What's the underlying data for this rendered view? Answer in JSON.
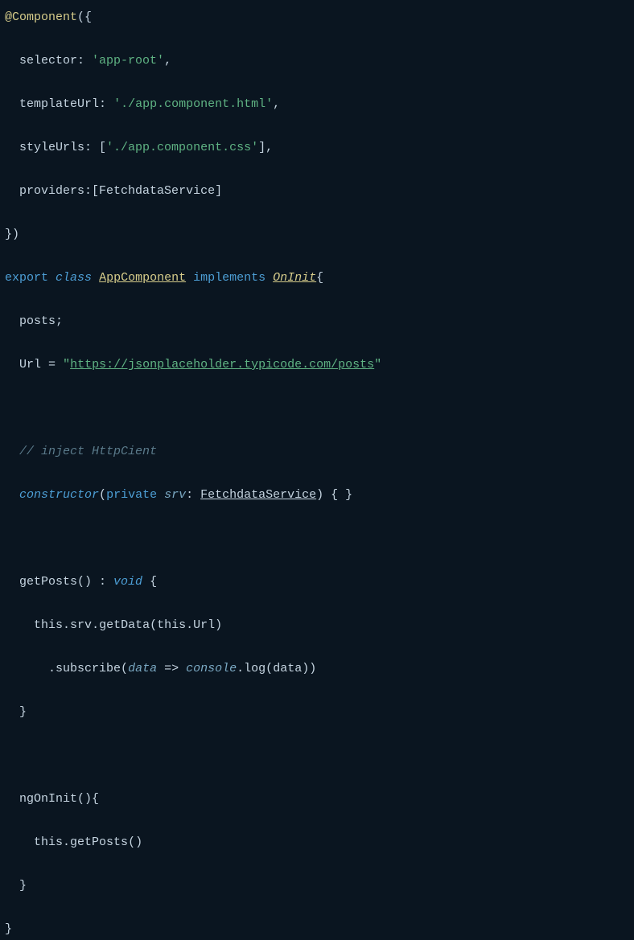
{
  "code": {
    "decorator": "@Component",
    "selectorKey": "selector",
    "selectorVal": "'app-root'",
    "templateUrlKey": "templateUrl",
    "templateUrlVal": "'./app.component.html'",
    "styleUrlsKey": "styleUrls",
    "styleUrlsVal": "'./app.component.css'",
    "providersKey": "providers",
    "providersVal": "FetchdataService",
    "exportKw": "export",
    "classKw": "class",
    "className": "AppComponent",
    "implementsKw": "implements",
    "interfaceName": "OnInit",
    "postsProp": "posts",
    "urlProp": "Url",
    "urlOpen": "\"",
    "urlVal": "https://jsonplaceholder.typicode.com/posts",
    "urlClose": "\"",
    "comment1": "// inject HttpCient",
    "ctorKw": "constructor",
    "privateKw": "private",
    "ctorParam": "srv",
    "ctorParamType": "FetchdataService",
    "getPostsName": "getPosts",
    "voidKw": "void",
    "thisKw1": "this",
    "srvProp": "srv",
    "getDataFn": "getData",
    "thisKw2": "this",
    "urlArg": "Url",
    "subscribeFn": "subscribe",
    "dataParam": "data",
    "arrow": "=>",
    "consoleObj": "console",
    "logFn": "log",
    "dataArg": "data",
    "ngOnInitName": "ngOnInit",
    "thisKw3": "this",
    "getPostsCall": "getPosts"
  }
}
